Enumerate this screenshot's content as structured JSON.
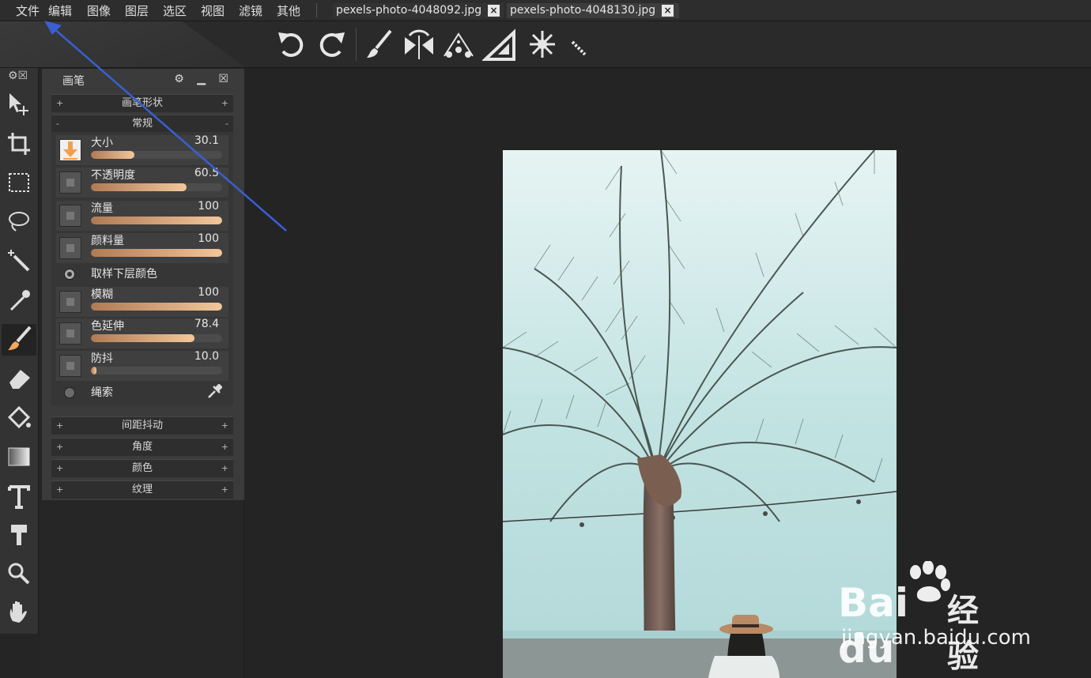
{
  "menubar": {
    "items": [
      "文件",
      "编辑",
      "图像",
      "图层",
      "选区",
      "视图",
      "滤镜",
      "其他"
    ],
    "tabs": [
      "pexels-photo-4048092.jpg",
      "pexels-photo-4048130.jpg"
    ],
    "close_glyph": "×"
  },
  "toolbar": {
    "icons": [
      "undo-icon",
      "redo-icon",
      "brush-icon",
      "symmetry-icon",
      "spray-icon",
      "ruler-triangle-icon",
      "snowflake-icon",
      "ruler-icon"
    ]
  },
  "tools": {
    "header": "⚙☒",
    "items": [
      "move-icon",
      "crop-icon",
      "marquee-icon",
      "lasso-icon",
      "magic-wand-icon",
      "eyedropper-icon",
      "brush-icon",
      "eraser-icon",
      "paint-bucket-icon",
      "gradient-icon",
      "text-icon",
      "clone-stamp-icon",
      "zoom-icon",
      "hand-icon"
    ],
    "active": "brush-icon"
  },
  "panel": {
    "title": "画笔",
    "icons": "⚙ ▁ ☒",
    "sections_top": [
      {
        "sign": "+",
        "label": "画笔形状"
      },
      {
        "sign": "-",
        "label": "常规"
      }
    ],
    "sliders": [
      {
        "label": "大小",
        "value": "30.1",
        "fraction": 0.33,
        "checked": true
      },
      {
        "label": "不透明度",
        "value": "60.5",
        "fraction": 0.73,
        "checked": false
      },
      {
        "label": "流量",
        "value": "100",
        "fraction": 1.0,
        "checked": false
      },
      {
        "label": "颜料量",
        "value": "100",
        "fraction": 1.0,
        "checked": false
      }
    ],
    "radio_sample": {
      "label": "取样下层颜色",
      "checked": true
    },
    "sliders2": [
      {
        "label": "模糊",
        "value": "100",
        "fraction": 1.0,
        "checked": false
      },
      {
        "label": "色延伸",
        "value": "78.4",
        "fraction": 0.79,
        "checked": false
      },
      {
        "label": "防抖",
        "value": "10.0",
        "fraction": 0.04,
        "checked": false
      }
    ],
    "radio_lasso": {
      "label": "绳索",
      "checked": false
    },
    "sections_bottom": [
      {
        "sign": "+",
        "label": "间距抖动"
      },
      {
        "sign": "+",
        "label": "角度"
      },
      {
        "sign": "+",
        "label": "颜色"
      },
      {
        "sign": "+",
        "label": "纹理"
      }
    ]
  },
  "watermark": {
    "brand": "Bai du",
    "cn": "经验",
    "url": "jingyan.baidu.com"
  },
  "colors": {
    "accent_slider": "#f2c79a",
    "arrow": "#3a5fd0"
  }
}
